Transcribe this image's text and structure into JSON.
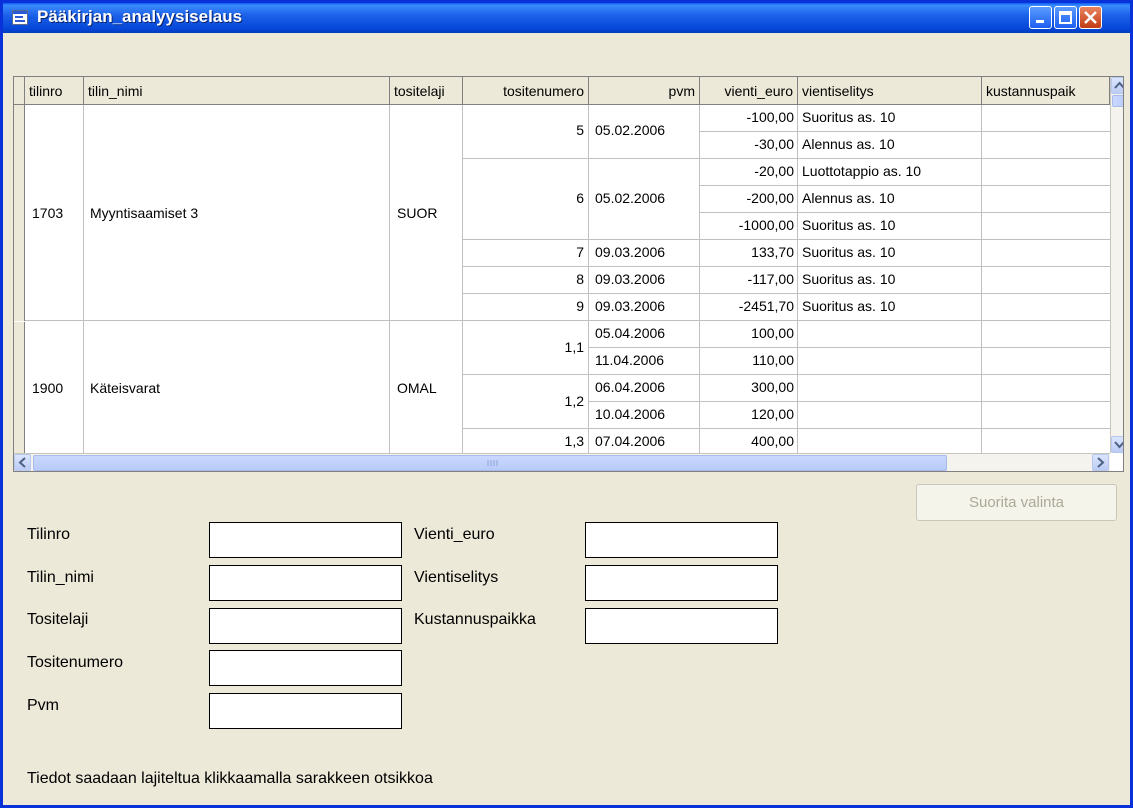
{
  "window": {
    "title": "Pääkirjan_analyysiselaus",
    "colors": {
      "titlebar": "#0a5ef6",
      "face": "#ece9d8",
      "close": "#c13a13"
    }
  },
  "grid": {
    "columns": [
      "tilinro",
      "tilin_nimi",
      "tositelaji",
      "tositenumero",
      "pvm",
      "vienti_euro",
      "vientiselitys",
      "kustannuspaik"
    ],
    "groups": [
      {
        "tilinro": "1703",
        "tilin_nimi": "Myyntisaamiset 3",
        "tositelaji": "SUOR"
      },
      {
        "tilinro": "1900",
        "tilin_nimi": "Käteisvarat",
        "tositelaji": "OMAL"
      }
    ],
    "entries": [
      {
        "tositenumero": "5",
        "pvm": "05.02.2006",
        "lines": [
          {
            "euro": "-100,00",
            "text": "Suoritus as. 10"
          },
          {
            "euro": "-30,00",
            "text": "Alennus as. 10"
          }
        ]
      },
      {
        "tositenumero": "6",
        "pvm": "05.02.2006",
        "lines": [
          {
            "euro": "-20,00",
            "text": "Luottotappio as. 10"
          },
          {
            "euro": "-200,00",
            "text": "Alennus as. 10"
          },
          {
            "euro": "-1000,00",
            "text": "Suoritus as. 10"
          }
        ]
      },
      {
        "tositenumero": "7",
        "pvm": "09.03.2006",
        "lines": [
          {
            "euro": "133,70",
            "text": "Suoritus as. 10"
          }
        ]
      },
      {
        "tositenumero": "8",
        "pvm": "09.03.2006",
        "lines": [
          {
            "euro": "-117,00",
            "text": "Suoritus as. 10"
          }
        ]
      },
      {
        "tositenumero": "9",
        "pvm": "09.03.2006",
        "lines": [
          {
            "euro": "-2451,70",
            "text": "Suoritus as. 10"
          }
        ]
      },
      {
        "tositenumero": "1,1",
        "dates": [
          "05.04.2006",
          "11.04.2006"
        ],
        "lines": [
          {
            "euro": "100,00",
            "text": ""
          },
          {
            "euro": "110,00",
            "text": ""
          }
        ]
      },
      {
        "tositenumero": "1,2",
        "dates": [
          "06.04.2006",
          "10.04.2006"
        ],
        "lines": [
          {
            "euro": "300,00",
            "text": ""
          },
          {
            "euro": "120,00",
            "text": ""
          }
        ]
      },
      {
        "tositenumero": "1,3",
        "dates": [
          "07.04.2006"
        ],
        "lines": [
          {
            "euro": "400,00",
            "text": ""
          }
        ]
      }
    ]
  },
  "form": {
    "button": "Suorita valinta",
    "left_fields": [
      "Tilinro",
      "Tilin_nimi",
      "Tositelaji",
      "Tositenumero",
      "Pvm"
    ],
    "right_fields": [
      "Vienti_euro",
      "Vientiselitys",
      "Kustannuspaikka"
    ],
    "left_values": [
      "",
      "",
      "",
      "",
      ""
    ],
    "right_values": [
      "",
      "",
      ""
    ]
  },
  "status": "Tiedot saadaan lajiteltua klikkaamalla sarakkeen otsikkoa",
  "icons": [
    "app-icon",
    "minimize-icon",
    "maximize-icon",
    "close-icon",
    "scroll-up-icon",
    "scroll-down-icon",
    "scroll-left-icon",
    "scroll-right-icon"
  ]
}
